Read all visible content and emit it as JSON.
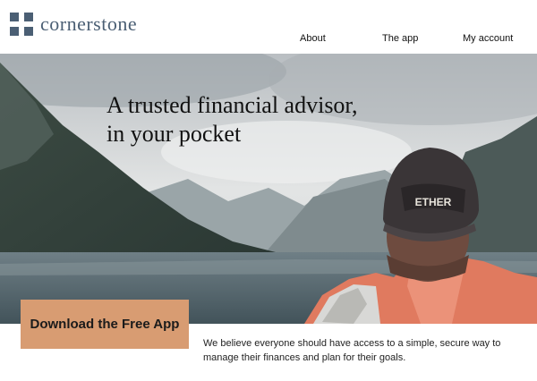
{
  "brand": {
    "name": "cornerstone",
    "color": "#4b5f74"
  },
  "nav": {
    "items": [
      {
        "label": "About"
      },
      {
        "label": "The app"
      },
      {
        "label": "My account"
      }
    ]
  },
  "hero": {
    "title_line1": "A trusted financial advisor,",
    "title_line2": "in your pocket",
    "image": "mountain-lake-hiker-photo"
  },
  "cta": {
    "label": "Download the Free App",
    "color": "#d89c72"
  },
  "tagline": {
    "line1": "We believe everyone should have access to a simple, secure way to",
    "line2": "manage their finances and plan for their goals."
  }
}
